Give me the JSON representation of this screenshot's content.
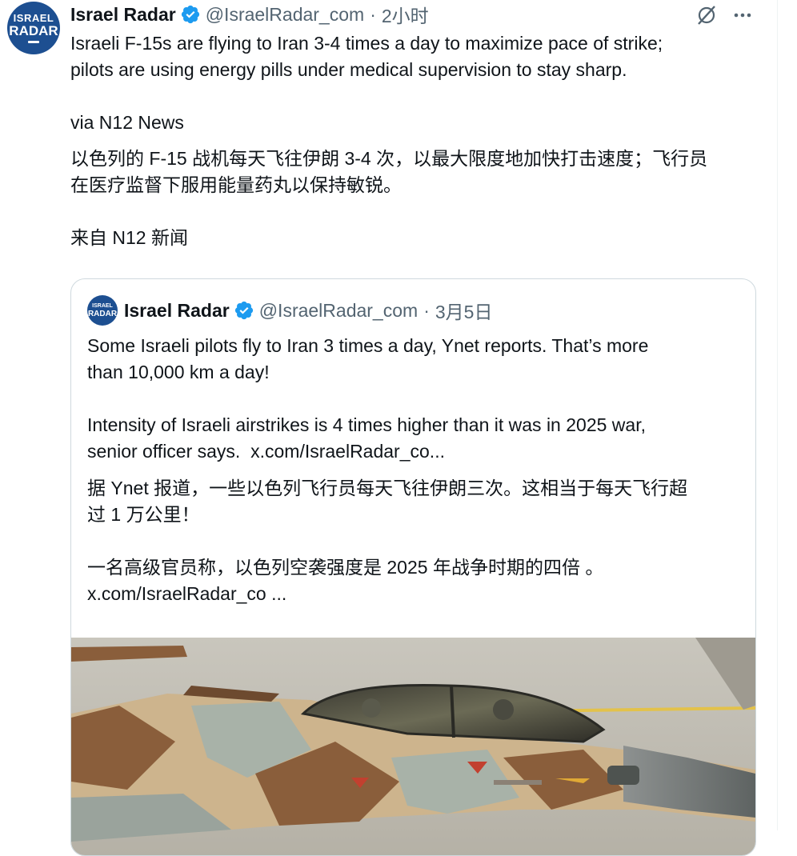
{
  "tweet": {
    "avatar_line1": "ISRAEL",
    "avatar_line2": "RADAR",
    "author_name": "Israel Radar",
    "handle": "@IsraelRadar_com",
    "separator": "·",
    "time": "2小时",
    "text": "Israeli F-15s are flying to Iran 3-4 times a day to maximize pace of strike;\npilots are using energy pills under medical supervision to stay sharp.\n\nvia N12 News",
    "translation": "以色列的 F-15 战机每天飞往伊朗 3-4 次，以最大限度地加快打击速度；飞行员\n在医疗监督下服用能量药丸以保持敏锐。\n\n来自 N12 新闻"
  },
  "quote": {
    "avatar_line1": "ISRAEL",
    "avatar_line2": "RADAR",
    "author_name": "Israel Radar",
    "handle": "@IsraelRadar_com",
    "separator": "·",
    "time": "3月5日",
    "text": "Some Israeli pilots fly to Iran 3 times a day, Ynet reports. That’s more\nthan 10,000 km a day!\n\nIntensity of Israeli airstrikes is 4 times higher than it was in 2025 war,\nsenior officer says.  x.com/IsraelRadar_co...",
    "translation": "据 Ynet 报道，一些以色列飞行员每天飞往伊朗三次。这相当于每天飞行超\n过 1 万公里！\n\n一名高级官员称，以色列空袭强度是 2025 年战争时期的四倍 。\nx.com/IsraelRadar_co ..."
  },
  "icons": {
    "verified": "verified-badge-icon",
    "grok": "grok-icon",
    "more": "more-options-icon"
  },
  "colors": {
    "verified_blue": "#1d9bf0",
    "muted_text": "#536471",
    "avatar_bg": "#1d4f91"
  }
}
